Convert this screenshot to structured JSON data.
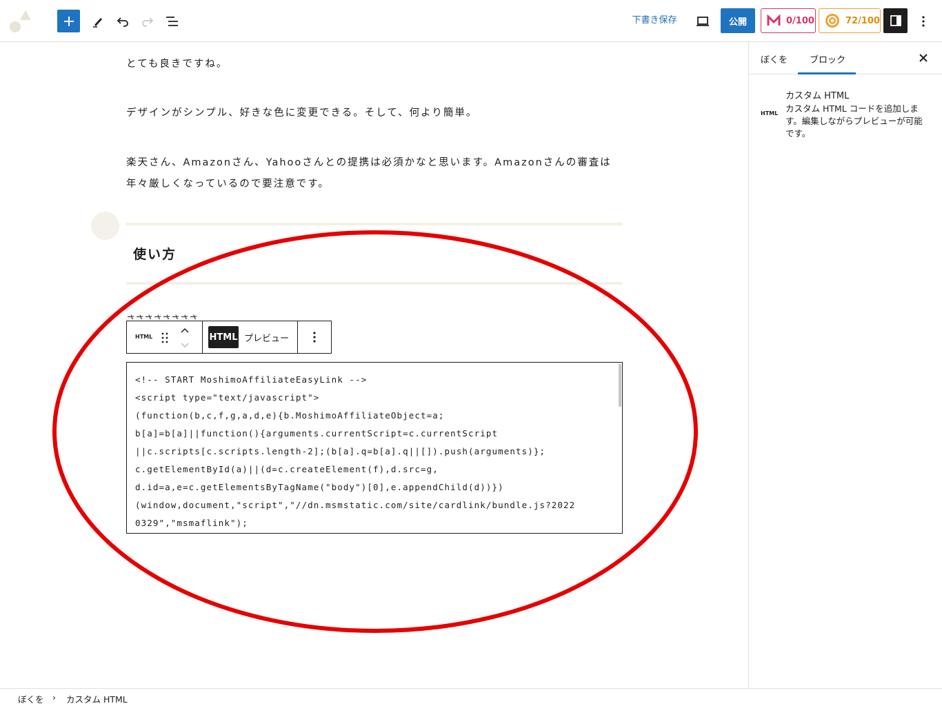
{
  "toolbar": {
    "add_icon": "plus-icon",
    "tools_icon": "pencil-icon",
    "undo_icon": "undo-icon",
    "redo_icon": "redo-icon",
    "list_view_icon": "list-view-icon",
    "save_draft_label": "下書き保存",
    "preview_icon": "desktop-preview-icon",
    "publish_label": "公開",
    "score_a": "0/100",
    "score_b": "72/100",
    "settings_icon": "sidebar-settings-icon",
    "more_icon": "more-vertical-icon",
    "accent_color": "#1e74c0"
  },
  "content": {
    "paragraphs": [
      "とても良きですね。",
      "デザインがシンプル、好きな色に変更できる。そして、何より簡単。",
      "楽天さん、Amazonさん、Yahooさんとの提携は必須かなと思います。Amazonさんの審査は",
      "年々厳しくなっているので要注意です。"
    ],
    "heading": "使い方",
    "hidden_text": "ささささささささ"
  },
  "block_toolbar": {
    "block_type_label": "HTML",
    "mode_html": "HTML",
    "mode_preview": "プレビュー"
  },
  "code": {
    "lines": [
      "<!-- START MoshimoAffiliateEasyLink -->",
      "<script type=\"text/javascript\">",
      "(function(b,c,f,g,a,d,e){b.MoshimoAffiliateObject=a;",
      "b[a]=b[a]||function(){arguments.currentScript=c.currentScript",
      "||c.scripts[c.scripts.length-2];(b[a].q=b[a].q||[]).push(arguments)};",
      "c.getElementById(a)||(d=c.createElement(f),d.src=g,",
      "d.id=a,e=c.getElementsByTagName(\"body\")[0],e.appendChild(d))})",
      "(window,document,\"script\",\"//dn.msmstatic.com/site/cardlink/bundle.js?2022",
      "0329\",\"msmaflink\");"
    ]
  },
  "sidebar": {
    "tab_document": "ぼくを",
    "tab_block": "ブロック",
    "block_icon_label": "HTML",
    "block_title": "カスタム HTML",
    "block_desc_1": "カスタム HTML コードを追加しま",
    "block_desc_2": "す。編集しながらプレビューが可能",
    "block_desc_3": "です。"
  },
  "footer": {
    "crumb_1": "ぼくを",
    "separator": "›",
    "crumb_2": "カスタム HTML"
  },
  "annotation_color": "#e60000"
}
